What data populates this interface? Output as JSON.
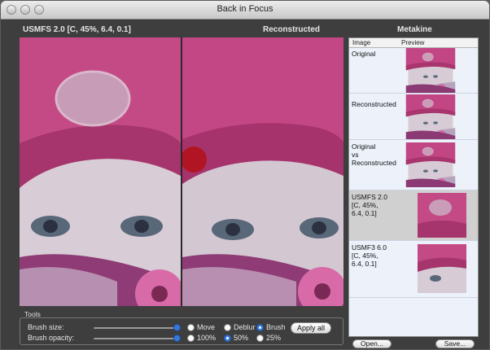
{
  "window": {
    "title": "Back in Focus"
  },
  "headers": {
    "left": "USMFS 2.0 [C, 45%, 6.4, 0.1]",
    "center": "Reconstructed",
    "right": "Metakine"
  },
  "side_panel": {
    "columns": [
      "Image",
      "Preview"
    ],
    "rows": [
      {
        "label": "Original"
      },
      {
        "label": "Reconstructed"
      },
      {
        "label": "Original\n vs\n Reconstructed"
      },
      {
        "label": "USMFS 2.0\n [C, 45%,\n 6.4, 0.1]",
        "selected": true
      },
      {
        "label": "USMF3 6.0\n [C, 45%,\n 6.4, 0.1]"
      }
    ]
  },
  "tools": {
    "group_label": "Tools",
    "brush_size_label": "Brush size:",
    "brush_opacity_label": "Brush opacity:",
    "mode_options": [
      {
        "label": "Move",
        "selected": false
      },
      {
        "label": "Deblur",
        "selected": false
      },
      {
        "label": "Brush",
        "selected": true
      }
    ],
    "opacity_options": [
      {
        "label": "100%",
        "selected": false
      },
      {
        "label": "50%",
        "selected": true
      },
      {
        "label": "25%",
        "selected": false
      }
    ],
    "apply_all_label": "Apply all"
  },
  "footer": {
    "open_label": "Open...",
    "save_label": "Save..."
  },
  "colors": {
    "hat": "#c0447c",
    "skin": "#d8cdd6",
    "brush_spot": "#b3121c",
    "panel_bg": "#ecf1fa"
  }
}
